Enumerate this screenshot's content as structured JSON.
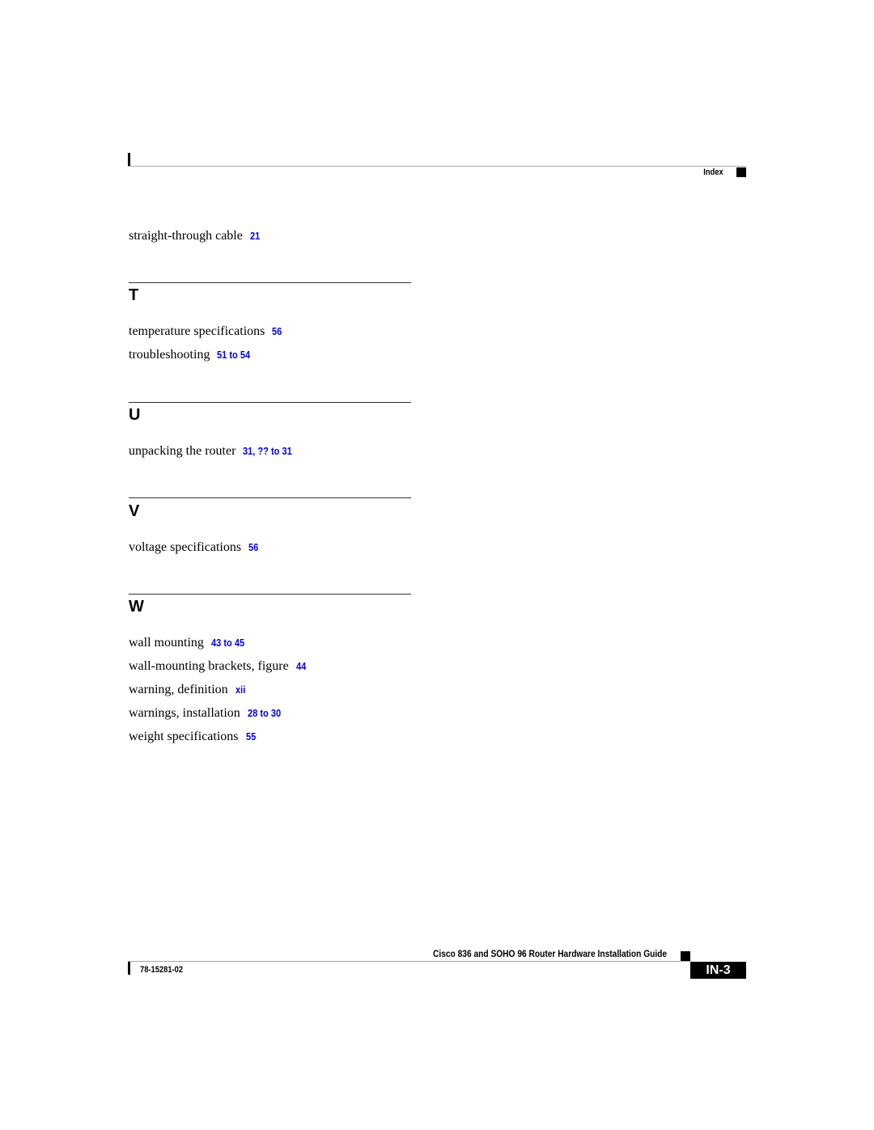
{
  "header": {
    "section_label": "Index"
  },
  "entries_top": [
    {
      "term": "straight-through cable",
      "pages": "21"
    }
  ],
  "sections": [
    {
      "letter": "T",
      "entries": [
        {
          "term": "temperature specifications",
          "pages": "56"
        },
        {
          "term": "troubleshooting",
          "pages": "51 to 54"
        }
      ]
    },
    {
      "letter": "U",
      "entries": [
        {
          "term": "unpacking the router",
          "pages": "31, ?? to 31"
        }
      ]
    },
    {
      "letter": "V",
      "entries": [
        {
          "term": "voltage specifications",
          "pages": "56"
        }
      ]
    },
    {
      "letter": "W",
      "entries": [
        {
          "term": "wall mounting",
          "pages": "43 to 45"
        },
        {
          "term": "wall-mounting brackets, figure",
          "pages": "44"
        },
        {
          "term": "warning, definition",
          "pages": "xii"
        },
        {
          "term": "warnings, installation",
          "pages": "28 to 30"
        },
        {
          "term": "weight specifications",
          "pages": "55"
        }
      ]
    }
  ],
  "footer": {
    "guide_title": "Cisco 836 and SOHO 96 Router Hardware Installation Guide",
    "doc_number": "78-15281-02",
    "page_number": "IN-3"
  },
  "colors": {
    "link": "#0000ee",
    "text": "#000000"
  }
}
